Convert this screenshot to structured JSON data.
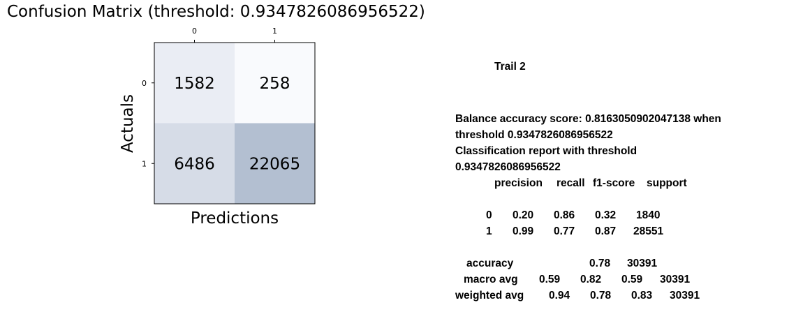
{
  "chart_data": {
    "type": "heatmap",
    "title": "Confusion Matrix (threshold: 0.9347826086956522)",
    "xlabel": "Predictions",
    "ylabel": "Actuals",
    "x_ticks": [
      "0",
      "1"
    ],
    "y_ticks": [
      "0",
      "1"
    ],
    "matrix": [
      [
        1582,
        258
      ],
      [
        6486,
        22065
      ]
    ],
    "colormap_color": "#b3bfd1"
  },
  "report": {
    "heading": "Trail 2",
    "balance_line_1": "Balance accuracy score: 0.8163050902047138 when",
    "balance_line_2": "threshold 0.9347826086956522",
    "class_report_line_1": "Classification report with threshold",
    "class_report_line_2": "0.9347826086956522",
    "columns": [
      "precision",
      "recall",
      "f1-score",
      "support"
    ],
    "rows": [
      {
        "label": "0",
        "values": [
          "0.20",
          "0.86",
          "0.32",
          "1840"
        ]
      },
      {
        "label": "1",
        "values": [
          "0.99",
          "0.77",
          "0.87",
          "28551"
        ]
      }
    ],
    "summary": [
      {
        "label": "accuracy",
        "values": [
          "",
          "",
          "0.78",
          "30391"
        ]
      },
      {
        "label": "macro avg",
        "values": [
          "0.59",
          "0.82",
          "0.59",
          "30391"
        ]
      },
      {
        "label": "weighted avg",
        "values": [
          "0.94",
          "0.78",
          "0.83",
          "30391"
        ]
      }
    ]
  }
}
